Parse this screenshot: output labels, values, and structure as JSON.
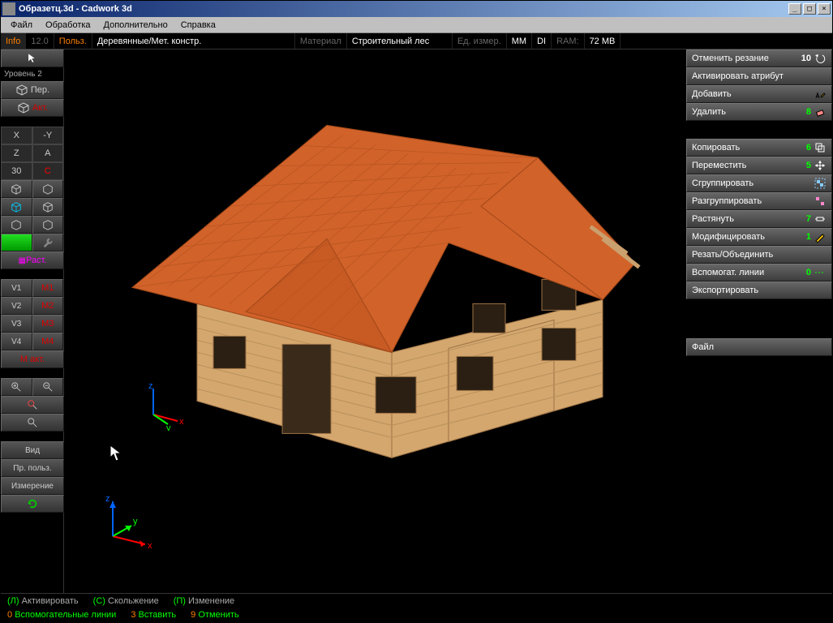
{
  "title": "Образетц.3d - Cadwork 3d",
  "menu": {
    "file": "Файл",
    "processing": "Обработка",
    "extra": "Дополнительно",
    "help": "Справка"
  },
  "infobar": {
    "info": "Info",
    "version": "12.0",
    "user": "Польз.",
    "mode": "Деревянные/Мет. констр.",
    "material_lbl": "Материал",
    "material_val": "Строительный лес",
    "unit_lbl": "Ед. измер.",
    "unit_val": "MM",
    "di": "DI",
    "ram_lbl": "RAM:",
    "ram_val": "72 MB"
  },
  "left": {
    "level": "Уровень 2",
    "per": "Пер.",
    "akt": "Акт.",
    "axes": {
      "x": "X",
      "ny": "-Y",
      "z": "Z",
      "a": "A",
      "thirty": "30",
      "c": "C"
    },
    "rast": "Раст.",
    "v1": "V1",
    "v2": "V2",
    "v3": "V3",
    "v4": "V4",
    "m1": "M1",
    "m2": "M2",
    "m3": "M3",
    "m4": "M4",
    "mact": "М акт.",
    "view": "Вид",
    "user_pref": "Пр. польз.",
    "measure": "Измерение"
  },
  "right": {
    "undo_cut": "Отменить резание",
    "undo_cut_n": "10",
    "activate_attr": "Активировать атрибут",
    "add": "Добавить",
    "delete": "Удалить",
    "delete_n": "8",
    "copy": "Копировать",
    "copy_n": "6",
    "move": "Переместить",
    "move_n": "5",
    "group": "Сгруппировать",
    "ungroup": "Разгруппировать",
    "stretch": "Растянуть",
    "stretch_n": "7",
    "modify": "Модифицировать",
    "modify_n": "1",
    "cut_join": "Резать/Объединить",
    "aux_lines": "Вспомогат. линии",
    "aux_lines_n": "0",
    "export": "Экспортировать",
    "file": "Файл"
  },
  "status": {
    "l_key": "(Л)",
    "l_txt": "Активировать",
    "c_key": "(С)",
    "c_txt": "Скольжение",
    "p_key": "(П)",
    "p_txt": "Изменение",
    "zero": "0",
    "aux": "Вспомогательные линии",
    "three": "3",
    "insert": "Вставить",
    "nine": "9",
    "cancel": "Отменить"
  }
}
